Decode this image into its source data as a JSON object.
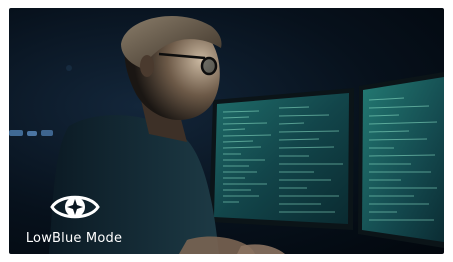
{
  "badge": {
    "label": "LowBlue Mode",
    "icon": "eye-icon",
    "color": "#ffffff"
  },
  "colors": {
    "background": "#050d16",
    "screen_glow": "#3fb5a0",
    "code_text": "#8ee3c9"
  }
}
